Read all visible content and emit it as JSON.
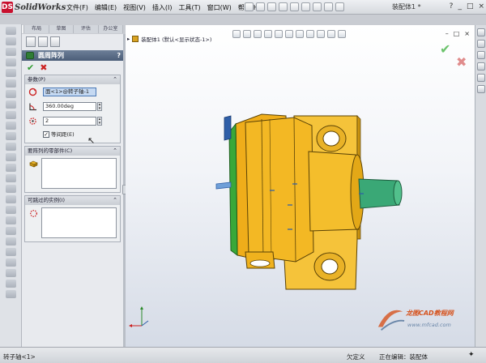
{
  "app": {
    "brand": "SolidWorks",
    "brand_prefix": "DS",
    "doc_title": "装配体1 *",
    "menu": [
      "文件(F)",
      "编辑(E)",
      "视图(V)",
      "插入(I)",
      "工具(T)",
      "窗口(W)",
      "帮助(H)"
    ]
  },
  "manager_tabs": [
    "装配",
    "布局",
    "草图",
    "评估",
    "办公室"
  ],
  "property_manager": {
    "title": "圆周阵列",
    "help": "?",
    "ok": "✔",
    "cancel": "✖",
    "params": {
      "header": "参数(P)",
      "axis_value": "面<1>@转子轴-1",
      "angle_value": "360.00deg",
      "count_value": "2",
      "equal_spacing_label": "等间距(E)",
      "equal_spacing_checked": "✓"
    },
    "components": {
      "header": "要阵列的零部件(C)"
    },
    "skip": {
      "header": "可跳过的实例(I)"
    }
  },
  "viewport": {
    "tree_label": "装配体1 (默认<显示状态-1>)",
    "watermark_name": "龙图CAD教程网",
    "watermark_url": "www.mfcad.com"
  },
  "status": {
    "left": "转子轴<1>",
    "mid1": "欠定义",
    "mid2": "正在编辑：装配体"
  },
  "colors": {
    "housing": "#f0b21e",
    "shaft": "#3aa876",
    "face_green": "#39a839",
    "accent_blue": "#2f5fa8"
  }
}
